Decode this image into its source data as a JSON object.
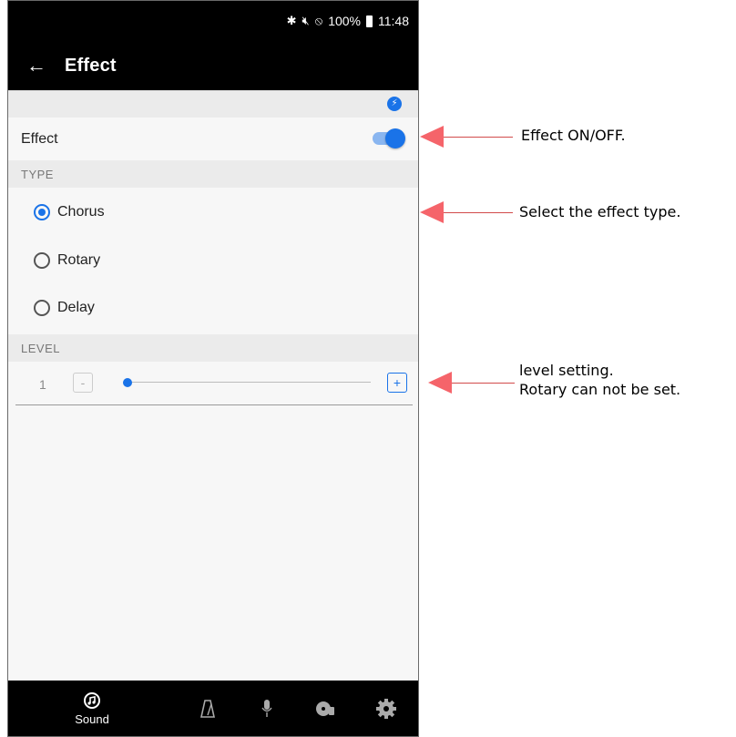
{
  "status_bar": {
    "icons": [
      "bluetooth-icon",
      "mute-icon",
      "do-not-disturb-icon"
    ],
    "battery": "100%",
    "time": "11:48"
  },
  "app_bar": {
    "back_icon": "arrow-left-icon",
    "title": "Effect"
  },
  "effect_row": {
    "label": "Effect",
    "toggle_on": true
  },
  "type_section": {
    "header": "TYPE",
    "options": [
      {
        "label": "Chorus",
        "selected": true
      },
      {
        "label": "Rotary",
        "selected": false
      },
      {
        "label": "Delay",
        "selected": false
      }
    ]
  },
  "level_section": {
    "header": "LEVEL",
    "value": "1",
    "minus": "-",
    "plus": "+",
    "slider_fraction": 0
  },
  "bottom_nav": {
    "items": [
      {
        "icon": "sound-icon",
        "label": "Sound"
      },
      {
        "icon": "metronome-icon"
      },
      {
        "icon": "microphone-icon"
      },
      {
        "icon": "record-icon"
      },
      {
        "icon": "gear-icon"
      }
    ]
  },
  "annotations": {
    "effect": "Effect ON/OFF.",
    "type": "Select the effect type.",
    "level_line1": "level setting.",
    "level_line2": "Rotary can not be set."
  },
  "colors": {
    "accent": "#1a73e8",
    "annotation_arrow": "#f5646a",
    "bar_bg": "#000000"
  }
}
